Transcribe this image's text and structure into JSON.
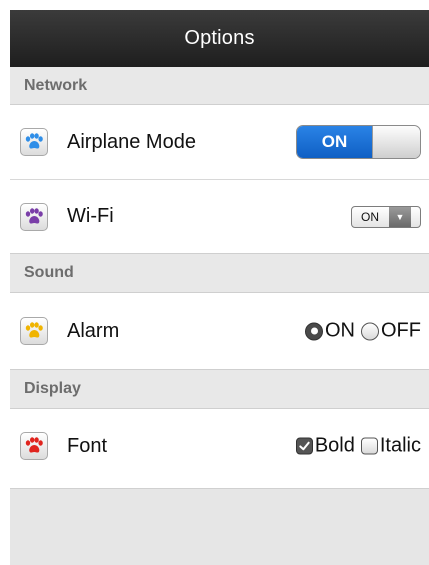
{
  "title": "Options",
  "sections": {
    "network": {
      "header": "Network",
      "airplane": {
        "label": "Airplane Mode",
        "toggle_label": "ON",
        "toggle_on": true,
        "icon": "paw-icon",
        "icon_color": "#2f8ee8"
      },
      "wifi": {
        "label": "Wi-Fi",
        "selected": "ON",
        "icon": "paw-icon",
        "icon_color": "#7a3ea8"
      }
    },
    "sound": {
      "header": "Sound",
      "alarm": {
        "label": "Alarm",
        "options": [
          "ON",
          "OFF"
        ],
        "selected": "ON",
        "icon": "paw-icon",
        "icon_color": "#f0b400"
      }
    },
    "display": {
      "header": "Display",
      "font": {
        "label": "Font",
        "options": [
          "Bold",
          "Italic"
        ],
        "checked": [
          "Bold"
        ],
        "icon": "paw-icon",
        "icon_color": "#e0241e"
      }
    }
  },
  "colors": {
    "titlebar": "#2a2a2a",
    "toggle_on": "#1a6fd6",
    "section_bg": "#e8e8e8"
  }
}
